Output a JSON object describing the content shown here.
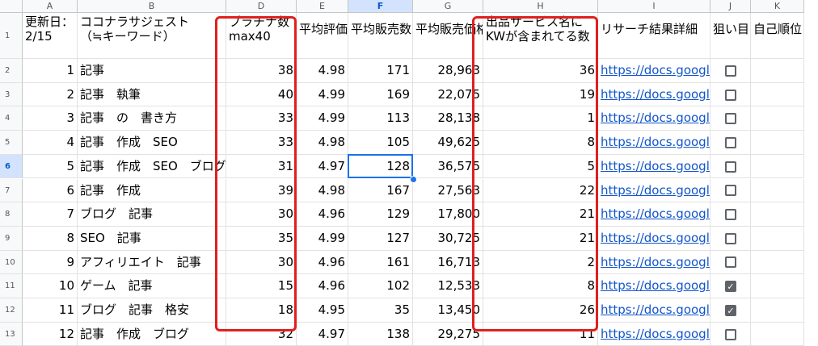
{
  "columns": [
    "A",
    "B",
    "D",
    "E",
    "F",
    "G",
    "H",
    "I",
    "J",
    "K"
  ],
  "selected_column": "F",
  "header_row": {
    "row_number": "1",
    "A": "更新日：\n2/15",
    "B": "ココナラサジェスト\n（≒キーワード）",
    "D": "プラチナ数\nmax40",
    "E": "平均評価",
    "F": "平均販売数",
    "G": "平均販売価格",
    "H": "出品サービス名に\nKWが含まれてる数",
    "I": "リサーチ結果詳細",
    "J": "狙い目",
    "K": "自己順位"
  },
  "selected_row": "6",
  "rows": [
    {
      "row_number": "2",
      "A": "1",
      "B": "記事",
      "D": "38",
      "E": "4.98",
      "F": "171",
      "G": "28,963",
      "H": "36",
      "I": "https://docs.google.com",
      "J": false
    },
    {
      "row_number": "3",
      "A": "2",
      "B": "記事　執筆",
      "D": "40",
      "E": "4.99",
      "F": "169",
      "G": "22,075",
      "H": "19",
      "I": "https://docs.google.com",
      "J": false
    },
    {
      "row_number": "4",
      "A": "3",
      "B": "記事　の　書き方",
      "D": "33",
      "E": "4.99",
      "F": "113",
      "G": "28,138",
      "H": "1",
      "I": "https://docs.google.com",
      "J": false
    },
    {
      "row_number": "5",
      "A": "4",
      "B": "記事　作成　SEO",
      "D": "33",
      "E": "4.98",
      "F": "105",
      "G": "49,625",
      "H": "8",
      "I": "https://docs.google.com",
      "J": false
    },
    {
      "row_number": "6",
      "A": "5",
      "B": "記事　作成　SEO　ブログ",
      "D": "31",
      "E": "4.97",
      "F": "128",
      "G": "36,575",
      "H": "5",
      "I": "https://docs.google.com",
      "J": false
    },
    {
      "row_number": "7",
      "A": "6",
      "B": "記事　作成",
      "D": "39",
      "E": "4.98",
      "F": "167",
      "G": "27,563",
      "H": "22",
      "I": "https://docs.google.com",
      "J": false
    },
    {
      "row_number": "8",
      "A": "7",
      "B": "ブログ　記事",
      "D": "30",
      "E": "4.96",
      "F": "129",
      "G": "17,800",
      "H": "21",
      "I": "https://docs.google.com",
      "J": false
    },
    {
      "row_number": "9",
      "A": "8",
      "B": "SEO　記事",
      "D": "35",
      "E": "4.99",
      "F": "127",
      "G": "30,725",
      "H": "21",
      "I": "https://docs.google.com",
      "J": false
    },
    {
      "row_number": "10",
      "A": "9",
      "B": "アフィリエイト　記事",
      "D": "30",
      "E": "4.96",
      "F": "161",
      "G": "16,713",
      "H": "2",
      "I": "https://docs.google.com",
      "J": false
    },
    {
      "row_number": "11",
      "A": "10",
      "B": "ゲーム　記事",
      "D": "15",
      "E": "4.96",
      "F": "102",
      "G": "12,533",
      "H": "8",
      "I": "https://docs.google.com",
      "J": true
    },
    {
      "row_number": "12",
      "A": "11",
      "B": "ブログ　記事　格安",
      "D": "18",
      "E": "4.95",
      "F": "35",
      "G": "13,450",
      "H": "26",
      "I": "https://docs.google.com",
      "J": true
    },
    {
      "row_number": "13",
      "A": "12",
      "B": "記事　作成　ブログ",
      "D": "32",
      "E": "4.97",
      "F": "138",
      "G": "29,275",
      "H": "11",
      "I": "https://docs.google.com",
      "J": false
    }
  ],
  "colors": {
    "highlight_box": "#e0201e",
    "selection": "#1a73e8",
    "link": "#1155cc"
  }
}
